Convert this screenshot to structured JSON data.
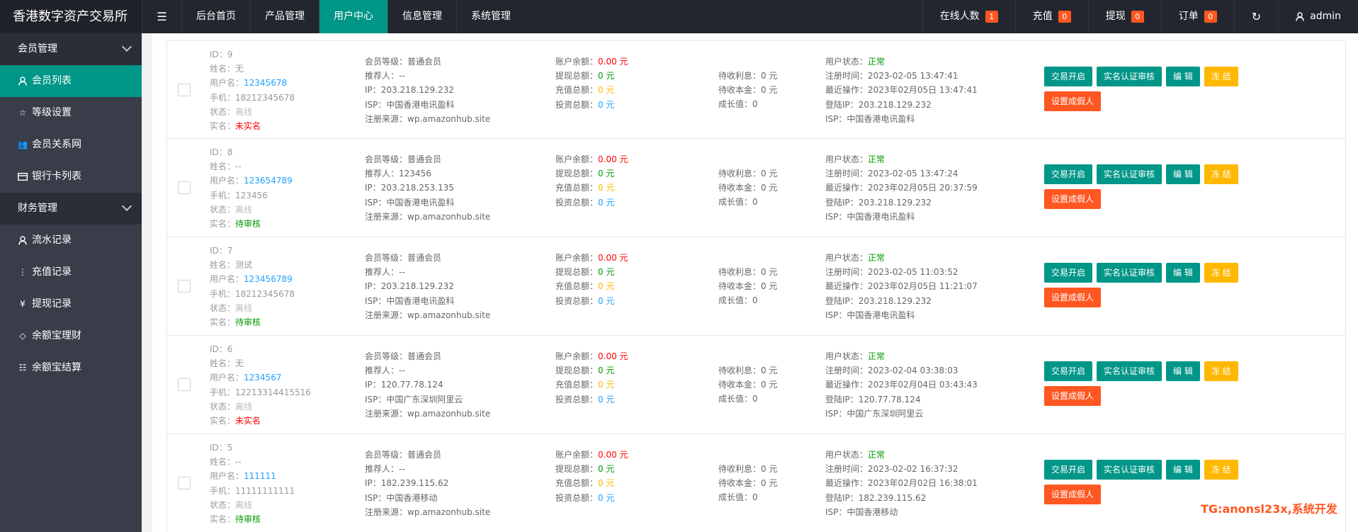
{
  "header": {
    "logo": "香港数字资产交易所",
    "nav": [
      "后台首页",
      "产品管理",
      "用户中心",
      "信息管理",
      "系统管理"
    ],
    "active_index": 2,
    "right": [
      {
        "label": "在线人数",
        "badge": "1"
      },
      {
        "label": "充值",
        "badge": "0"
      },
      {
        "label": "提现",
        "badge": "0"
      },
      {
        "label": "订单",
        "badge": "0"
      }
    ],
    "user": "admin"
  },
  "sidebar": {
    "groups": [
      {
        "label": "会员管理",
        "items": [
          {
            "label": "会员列表",
            "icon": "user-icon",
            "active": true
          },
          {
            "label": "等级设置",
            "icon": "star-icon"
          },
          {
            "label": "会员关系网",
            "icon": "users-icon"
          },
          {
            "label": "银行卡列表",
            "icon": "card-icon"
          }
        ]
      },
      {
        "label": "财务管理",
        "items": [
          {
            "label": "流水记录",
            "icon": "user-icon"
          },
          {
            "label": "充值记录",
            "icon": "more-vertical-icon"
          },
          {
            "label": "提现记录",
            "icon": "yen-icon"
          },
          {
            "label": "余额宝理财",
            "icon": "diamond-icon"
          },
          {
            "label": "余额宝结算",
            "icon": "server-icon"
          }
        ]
      }
    ]
  },
  "labels": {
    "id": "ID：",
    "name": "姓名：",
    "username": "用户名：",
    "phone": "手机：",
    "status": "状态：",
    "realname": "实名：",
    "level": "会员等级：",
    "referrer": "推荐人：",
    "ip": "IP：",
    "isp": "ISP：",
    "source": "注册来源：",
    "balance": "账户余额：",
    "withdraw_total": "提现总额：",
    "recharge_total": "充值总额：",
    "invest_total": "投资总额：",
    "pending_interest": "待收利息：",
    "pending_principal": "待收本金：",
    "growth": "成长值：",
    "user_status": "用户状态：",
    "reg_time": "注册时间：",
    "last_op": "最近操作：",
    "login_ip": "登陆IP：",
    "isp2": "ISP："
  },
  "buttons": {
    "trade": "交易开启",
    "verify": "实名认证审核",
    "edit": "编 辑",
    "freeze": "冻 结",
    "fake": "设置成假人"
  },
  "members": [
    {
      "id": "9",
      "name": "无",
      "username": "12345678",
      "phone": "18212345678",
      "status": "离线",
      "realname": "未实名",
      "realname_color": "red",
      "level": "普通会员",
      "referrer": "--",
      "ip": "203.218.129.232",
      "isp": "中国香港电讯盈科",
      "source": "wp.amazonhub.site",
      "balance": "0.00 元",
      "withdraw": "0 元",
      "recharge": "0 元",
      "invest": "0 元",
      "interest": "0 元",
      "principal": "0 元",
      "growth": "0",
      "user_status": "正常",
      "reg_time": "2023-02-05 13:47:41",
      "last_op": "2023年02月05日 13:47:41",
      "login_ip": "203.218.129.232",
      "isp2": "中国香港电讯盈科"
    },
    {
      "id": "8",
      "name": "--",
      "username": "123654789",
      "phone": "123456",
      "status": "离线",
      "realname": "待审核",
      "realname_color": "green",
      "level": "普通会员",
      "referrer": "123456",
      "ip": "203.218.253.135",
      "isp": "中国香港电讯盈科",
      "source": "wp.amazonhub.site",
      "balance": "0.00 元",
      "withdraw": "0 元",
      "recharge": "0 元",
      "invest": "0 元",
      "interest": "0 元",
      "principal": "0 元",
      "growth": "0",
      "user_status": "正常",
      "reg_time": "2023-02-05 13:47:24",
      "last_op": "2023年02月05日 20:37:59",
      "login_ip": "203.218.129.232",
      "isp2": "中国香港电讯盈科"
    },
    {
      "id": "7",
      "name": "测试",
      "username": "123456789",
      "phone": "18212345678",
      "status": "离线",
      "realname": "待审核",
      "realname_color": "green",
      "level": "普通会员",
      "referrer": "--",
      "ip": "203.218.129.232",
      "isp": "中国香港电讯盈科",
      "source": "wp.amazonhub.site",
      "balance": "0.00 元",
      "withdraw": "0 元",
      "recharge": "0 元",
      "invest": "0 元",
      "interest": "0 元",
      "principal": "0 元",
      "growth": "0",
      "user_status": "正常",
      "reg_time": "2023-02-05 11:03:52",
      "last_op": "2023年02月05日 11:21:07",
      "login_ip": "203.218.129.232",
      "isp2": "中国香港电讯盈科"
    },
    {
      "id": "6",
      "name": "无",
      "username": "1234567",
      "phone": "12213314415516",
      "status": "离线",
      "realname": "未实名",
      "realname_color": "red",
      "level": "普通会员",
      "referrer": "--",
      "ip": "120.77.78.124",
      "isp": "中国广东深圳阿里云",
      "source": "wp.amazonhub.site",
      "balance": "0.00 元",
      "withdraw": "0 元",
      "recharge": "0 元",
      "invest": "0 元",
      "interest": "0 元",
      "principal": "0 元",
      "growth": "0",
      "user_status": "正常",
      "reg_time": "2023-02-04 03:38:03",
      "last_op": "2023年02月04日 03:43:43",
      "login_ip": "120.77.78.124",
      "isp2": "中国广东深圳阿里云"
    },
    {
      "id": "5",
      "name": "--",
      "username": "111111",
      "phone": "11111111111",
      "status": "离线",
      "realname": "待审核",
      "realname_color": "green",
      "level": "普通会员",
      "referrer": "--",
      "ip": "182.239.115.62",
      "isp": "中国香港移动",
      "source": "wp.amazonhub.site",
      "balance": "0.00 元",
      "withdraw": "0 元",
      "recharge": "0 元",
      "invest": "0 元",
      "interest": "0 元",
      "principal": "0 元",
      "growth": "0",
      "user_status": "正常",
      "reg_time": "2023-02-02 16:37:32",
      "last_op": "2023年02月02日 16:38:01",
      "login_ip": "182.239.115.62",
      "isp2": "中国香港移动"
    }
  ],
  "watermark": "TG:anonsl23x,系统开发"
}
